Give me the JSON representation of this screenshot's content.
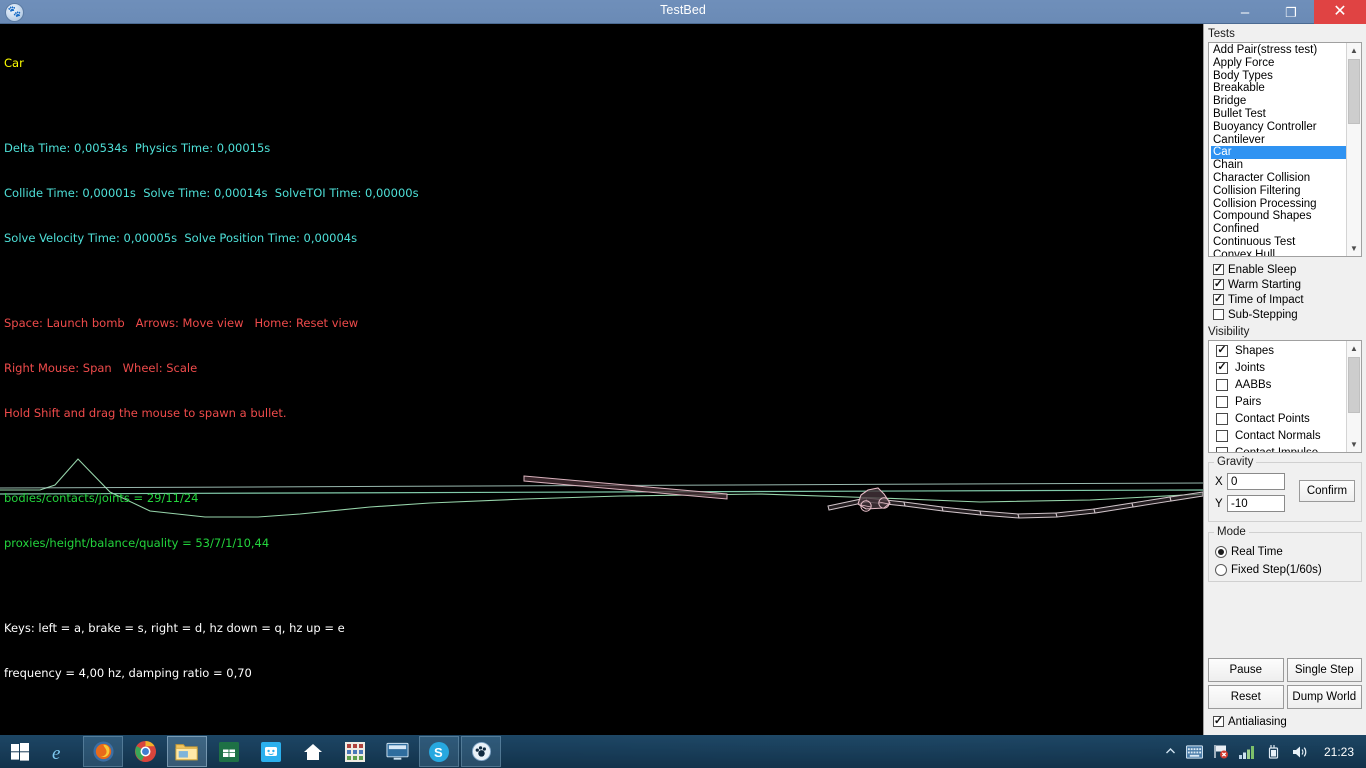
{
  "window": {
    "title": "TestBed",
    "icon": "paw-icon",
    "minimize_label": "–",
    "maximize_label": "❐",
    "close_label": "✕"
  },
  "canvas": {
    "test_name": "Car",
    "stats": [
      "Delta Time: 0,00534s  Physics Time: 0,00015s",
      "Collide Time: 0,00001s  Solve Time: 0,00014s  SolveTOI Time: 0,00000s",
      "Solve Velocity Time: 0,00005s  Solve Position Time: 0,00004s"
    ],
    "help": [
      "Space: Launch bomb   Arrows: Move view   Home: Reset view",
      "Right Mouse: Span   Wheel: Scale",
      "Hold Shift and drag the mouse to spawn a bullet."
    ],
    "counters": [
      "bodies/contacts/joints = 29/11/24",
      "proxies/height/balance/quality = 53/7/1/10,44"
    ],
    "keys": [
      "Keys: left = a, brake = s, right = d, hz down = q, hz up = e",
      "frequency = 4,00 hz, damping ratio = 0,70"
    ],
    "colors": {
      "title": "#ffff00",
      "stats": "#4ee0d8",
      "help": "#ef4b4b",
      "counters": "#23d43d",
      "keys": "#ffffff",
      "terrain": "#9fe0b4",
      "body": "#d9b2bd",
      "background": "#000000"
    }
  },
  "panel": {
    "tests_label": "Tests",
    "tests": [
      "Add Pair(stress test)",
      "Apply Force",
      "Body Types",
      "Breakable",
      "Bridge",
      "Bullet Test",
      "Buoyancy Controller",
      "Cantilever",
      "Car",
      "Chain",
      "Character Collision",
      "Collision Filtering",
      "Collision Processing",
      "Compound Shapes",
      "Confined",
      "Continuous Test",
      "Convex Hull"
    ],
    "tests_selected": "Car",
    "options": [
      {
        "label": "Enable Sleep",
        "checked": true
      },
      {
        "label": "Warm Starting",
        "checked": true
      },
      {
        "label": "Time of Impact",
        "checked": true
      },
      {
        "label": "Sub-Stepping",
        "checked": false
      }
    ],
    "visibility_label": "Visibility",
    "visibility": [
      {
        "label": "Shapes",
        "checked": true
      },
      {
        "label": "Joints",
        "checked": true
      },
      {
        "label": "AABBs",
        "checked": false
      },
      {
        "label": "Pairs",
        "checked": false
      },
      {
        "label": "Contact Points",
        "checked": false
      },
      {
        "label": "Contact Normals",
        "checked": false
      },
      {
        "label": "Contact Impulse",
        "checked": false
      }
    ],
    "gravity": {
      "legend": "Gravity",
      "x_label": "X",
      "x_value": "0",
      "y_label": "Y",
      "y_value": "-10",
      "confirm_label": "Confirm"
    },
    "mode": {
      "legend": "Mode",
      "options": [
        {
          "label": "Real Time",
          "selected": true
        },
        {
          "label": "Fixed Step(1/60s)",
          "selected": false
        }
      ]
    },
    "buttons": [
      "Pause",
      "Single Step",
      "Reset",
      "Dump World"
    ],
    "antialiasing": {
      "label": "Antialiasing",
      "checked": true
    },
    "accent": "#2f93f2"
  },
  "taskbar": {
    "start": "windows-logo-icon",
    "apps": [
      {
        "name": "internet-explorer-icon",
        "state": "idle"
      },
      {
        "name": "firefox-icon",
        "state": "running"
      },
      {
        "name": "chrome-icon",
        "state": "idle"
      },
      {
        "name": "file-explorer-icon",
        "state": "active"
      },
      {
        "name": "excel-icon",
        "state": "idle"
      },
      {
        "name": "messaging-icon",
        "state": "idle"
      },
      {
        "name": "home-icon",
        "state": "idle"
      },
      {
        "name": "apps-grid-icon",
        "state": "idle"
      },
      {
        "name": "monitor-icon",
        "state": "idle"
      },
      {
        "name": "skype-icon",
        "state": "running"
      },
      {
        "name": "testbed-paw-icon",
        "state": "running"
      }
    ],
    "tray": [
      "show-hidden-icons-chevron",
      "keyboard-icon",
      "flag-action-center-icon",
      "network-signal-icon",
      "battery-icon",
      "volume-icon"
    ],
    "clock": "21:23"
  }
}
